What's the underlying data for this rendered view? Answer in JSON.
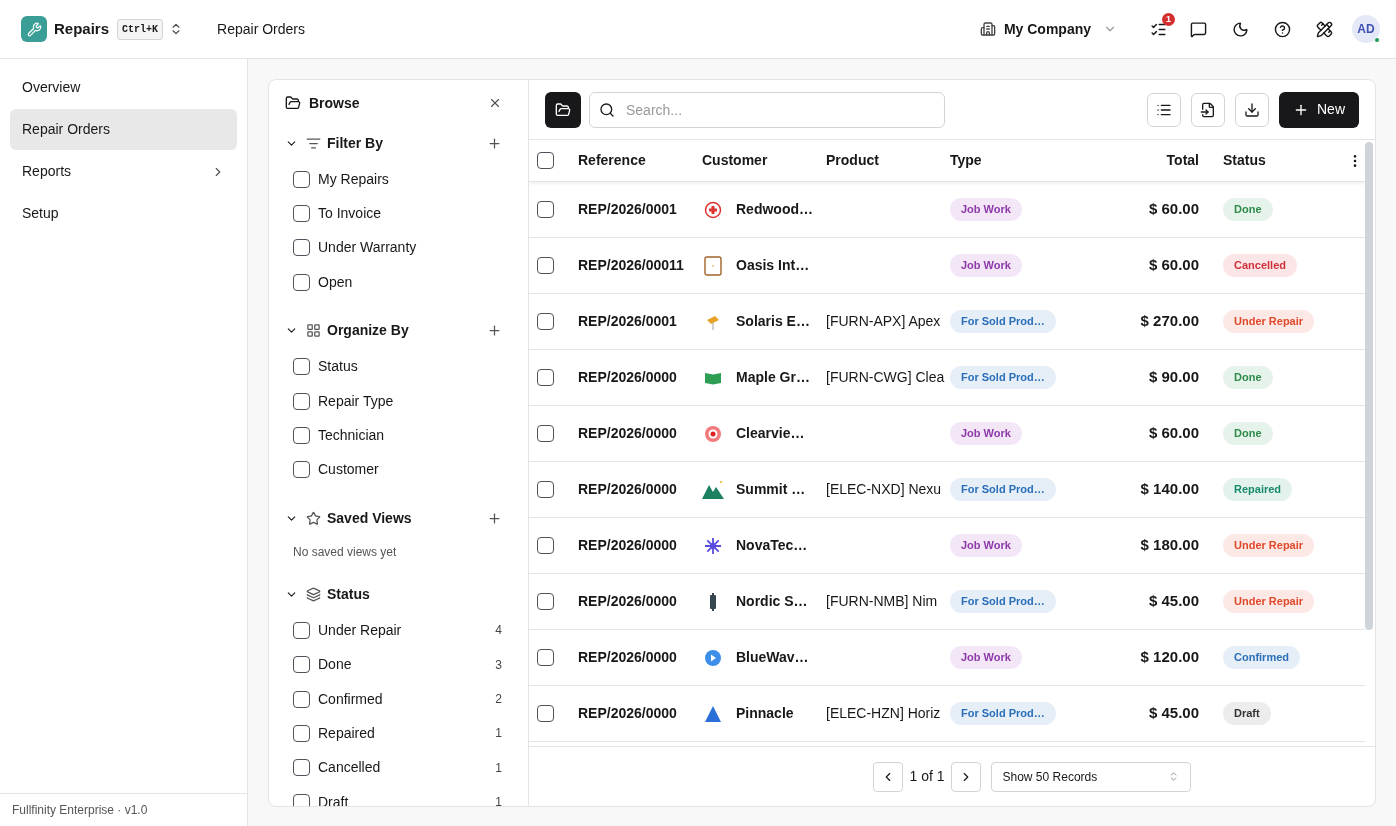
{
  "app": {
    "name": "Repairs",
    "shortcut": "Ctrl+K",
    "page": "Repair Orders"
  },
  "header": {
    "company": "My Company",
    "notifications": "1",
    "avatar": "AD"
  },
  "nav": [
    {
      "label": "Overview",
      "selected": false,
      "submenu": false
    },
    {
      "label": "Repair Orders",
      "selected": true,
      "submenu": false
    },
    {
      "label": "Reports",
      "selected": false,
      "submenu": true
    },
    {
      "label": "Setup",
      "selected": false,
      "submenu": false
    }
  ],
  "footer": "Fullfinity Enterprise · v1.0",
  "browse": {
    "title": "Browse",
    "sections": [
      {
        "kind": "filter",
        "title": "Filter By",
        "items": [
          {
            "label": "My Repairs",
            "checked": false
          },
          {
            "label": "To Invoice",
            "checked": false
          },
          {
            "label": "Under Warranty",
            "checked": false
          },
          {
            "label": "Open",
            "checked": false
          }
        ]
      },
      {
        "kind": "organize",
        "title": "Organize By",
        "items": [
          {
            "label": "Status",
            "checked": false
          },
          {
            "label": "Repair Type",
            "checked": false
          },
          {
            "label": "Technician",
            "checked": false
          },
          {
            "label": "Customer",
            "checked": false
          }
        ]
      },
      {
        "kind": "views",
        "title": "Saved Views",
        "empty": "No saved views yet"
      },
      {
        "kind": "status",
        "title": "Status",
        "items": [
          {
            "label": "Under Repair",
            "count": "4",
            "checked": false
          },
          {
            "label": "Done",
            "count": "3",
            "checked": false
          },
          {
            "label": "Confirmed",
            "count": "2",
            "checked": false
          },
          {
            "label": "Repaired",
            "count": "1",
            "checked": false
          },
          {
            "label": "Cancelled",
            "count": "1",
            "checked": false
          },
          {
            "label": "Draft",
            "count": "1",
            "checked": false
          }
        ]
      }
    ]
  },
  "toolbar": {
    "search_placeholder": "Search...",
    "new_button": "New"
  },
  "table": {
    "columns": [
      "Reference",
      "Customer",
      "Product",
      "Type",
      "Total",
      "Status"
    ],
    "all_checked": false,
    "rows": [
      {
        "reference": "REP/2026/0001",
        "customer": "Redwood…",
        "product": "",
        "type": {
          "label": "Job Work",
          "kind": "job"
        },
        "total": "$ 60.00",
        "status": {
          "label": "Done",
          "kind": "done"
        },
        "checked": false
      },
      {
        "reference": "REP/2026/00011",
        "customer": "Oasis Int…",
        "product": "",
        "type": {
          "label": "Job Work",
          "kind": "job"
        },
        "total": "$ 60.00",
        "status": {
          "label": "Cancelled",
          "kind": "cancelled"
        },
        "checked": false
      },
      {
        "reference": "REP/2026/0001",
        "customer": "Solaris E…",
        "product": "[FURN-APX] Apex",
        "type": {
          "label": "For Sold Prod…",
          "kind": "sold"
        },
        "total": "$ 270.00",
        "status": {
          "label": "Under Repair",
          "kind": "under_repair"
        },
        "checked": false
      },
      {
        "reference": "REP/2026/0000",
        "customer": "Maple Gr…",
        "product": "[FURN-CWG] Clea",
        "type": {
          "label": "For Sold Prod…",
          "kind": "sold"
        },
        "total": "$ 90.00",
        "status": {
          "label": "Done",
          "kind": "done"
        },
        "checked": false
      },
      {
        "reference": "REP/2026/0000",
        "customer": "Clearvie…",
        "product": "",
        "type": {
          "label": "Job Work",
          "kind": "job"
        },
        "total": "$ 60.00",
        "status": {
          "label": "Done",
          "kind": "done"
        },
        "checked": false
      },
      {
        "reference": "REP/2026/0000",
        "customer": "Summit …",
        "product": "[ELEC-NXD] Nexu",
        "type": {
          "label": "For Sold Prod…",
          "kind": "sold"
        },
        "total": "$ 140.00",
        "status": {
          "label": "Repaired",
          "kind": "repaired"
        },
        "checked": false
      },
      {
        "reference": "REP/2026/0000",
        "customer": "NovaTec…",
        "product": "",
        "type": {
          "label": "Job Work",
          "kind": "job"
        },
        "total": "$ 180.00",
        "status": {
          "label": "Under Repair",
          "kind": "under_repair"
        },
        "checked": false
      },
      {
        "reference": "REP/2026/0000",
        "customer": "Nordic S…",
        "product": "[FURN-NMB] Nim",
        "type": {
          "label": "For Sold Prod…",
          "kind": "sold"
        },
        "total": "$ 45.00",
        "status": {
          "label": "Under Repair",
          "kind": "under_repair"
        },
        "checked": false
      },
      {
        "reference": "REP/2026/0000",
        "customer": "BlueWav…",
        "product": "",
        "type": {
          "label": "Job Work",
          "kind": "job"
        },
        "total": "$ 120.00",
        "status": {
          "label": "Confirmed",
          "kind": "confirmed"
        },
        "checked": false
      },
      {
        "reference": "REP/2026/0000",
        "customer": "Pinnacle",
        "product": "[ELEC-HZN] Horiz",
        "type": {
          "label": "For Sold Prod…",
          "kind": "sold"
        },
        "total": "$ 45.00",
        "status": {
          "label": "Draft",
          "kind": "draft"
        },
        "checked": false
      }
    ]
  },
  "pagination": {
    "page": "1 of 1",
    "page_size": "Show 50 Records"
  }
}
